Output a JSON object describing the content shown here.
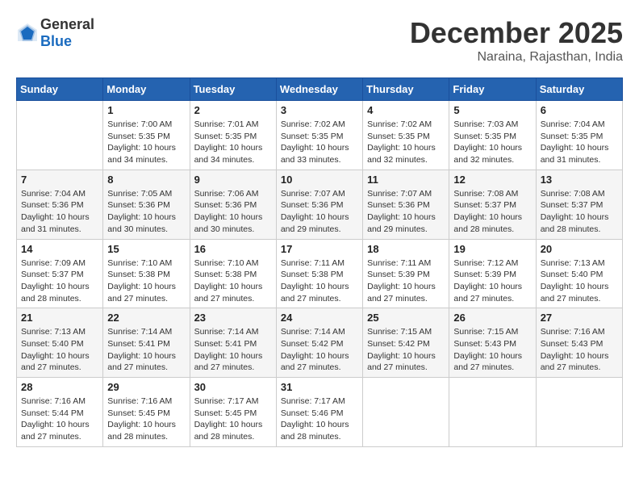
{
  "logo": {
    "general": "General",
    "blue": "Blue"
  },
  "title": {
    "month": "December 2025",
    "location": "Naraina, Rajasthan, India"
  },
  "headers": [
    "Sunday",
    "Monday",
    "Tuesday",
    "Wednesday",
    "Thursday",
    "Friday",
    "Saturday"
  ],
  "weeks": [
    [
      {
        "day": "",
        "info": ""
      },
      {
        "day": "1",
        "info": "Sunrise: 7:00 AM\nSunset: 5:35 PM\nDaylight: 10 hours\nand 34 minutes."
      },
      {
        "day": "2",
        "info": "Sunrise: 7:01 AM\nSunset: 5:35 PM\nDaylight: 10 hours\nand 34 minutes."
      },
      {
        "day": "3",
        "info": "Sunrise: 7:02 AM\nSunset: 5:35 PM\nDaylight: 10 hours\nand 33 minutes."
      },
      {
        "day": "4",
        "info": "Sunrise: 7:02 AM\nSunset: 5:35 PM\nDaylight: 10 hours\nand 32 minutes."
      },
      {
        "day": "5",
        "info": "Sunrise: 7:03 AM\nSunset: 5:35 PM\nDaylight: 10 hours\nand 32 minutes."
      },
      {
        "day": "6",
        "info": "Sunrise: 7:04 AM\nSunset: 5:35 PM\nDaylight: 10 hours\nand 31 minutes."
      }
    ],
    [
      {
        "day": "7",
        "info": "Sunrise: 7:04 AM\nSunset: 5:36 PM\nDaylight: 10 hours\nand 31 minutes."
      },
      {
        "day": "8",
        "info": "Sunrise: 7:05 AM\nSunset: 5:36 PM\nDaylight: 10 hours\nand 30 minutes."
      },
      {
        "day": "9",
        "info": "Sunrise: 7:06 AM\nSunset: 5:36 PM\nDaylight: 10 hours\nand 30 minutes."
      },
      {
        "day": "10",
        "info": "Sunrise: 7:07 AM\nSunset: 5:36 PM\nDaylight: 10 hours\nand 29 minutes."
      },
      {
        "day": "11",
        "info": "Sunrise: 7:07 AM\nSunset: 5:36 PM\nDaylight: 10 hours\nand 29 minutes."
      },
      {
        "day": "12",
        "info": "Sunrise: 7:08 AM\nSunset: 5:37 PM\nDaylight: 10 hours\nand 28 minutes."
      },
      {
        "day": "13",
        "info": "Sunrise: 7:08 AM\nSunset: 5:37 PM\nDaylight: 10 hours\nand 28 minutes."
      }
    ],
    [
      {
        "day": "14",
        "info": "Sunrise: 7:09 AM\nSunset: 5:37 PM\nDaylight: 10 hours\nand 28 minutes."
      },
      {
        "day": "15",
        "info": "Sunrise: 7:10 AM\nSunset: 5:38 PM\nDaylight: 10 hours\nand 27 minutes."
      },
      {
        "day": "16",
        "info": "Sunrise: 7:10 AM\nSunset: 5:38 PM\nDaylight: 10 hours\nand 27 minutes."
      },
      {
        "day": "17",
        "info": "Sunrise: 7:11 AM\nSunset: 5:38 PM\nDaylight: 10 hours\nand 27 minutes."
      },
      {
        "day": "18",
        "info": "Sunrise: 7:11 AM\nSunset: 5:39 PM\nDaylight: 10 hours\nand 27 minutes."
      },
      {
        "day": "19",
        "info": "Sunrise: 7:12 AM\nSunset: 5:39 PM\nDaylight: 10 hours\nand 27 minutes."
      },
      {
        "day": "20",
        "info": "Sunrise: 7:13 AM\nSunset: 5:40 PM\nDaylight: 10 hours\nand 27 minutes."
      }
    ],
    [
      {
        "day": "21",
        "info": "Sunrise: 7:13 AM\nSunset: 5:40 PM\nDaylight: 10 hours\nand 27 minutes."
      },
      {
        "day": "22",
        "info": "Sunrise: 7:14 AM\nSunset: 5:41 PM\nDaylight: 10 hours\nand 27 minutes."
      },
      {
        "day": "23",
        "info": "Sunrise: 7:14 AM\nSunset: 5:41 PM\nDaylight: 10 hours\nand 27 minutes."
      },
      {
        "day": "24",
        "info": "Sunrise: 7:14 AM\nSunset: 5:42 PM\nDaylight: 10 hours\nand 27 minutes."
      },
      {
        "day": "25",
        "info": "Sunrise: 7:15 AM\nSunset: 5:42 PM\nDaylight: 10 hours\nand 27 minutes."
      },
      {
        "day": "26",
        "info": "Sunrise: 7:15 AM\nSunset: 5:43 PM\nDaylight: 10 hours\nand 27 minutes."
      },
      {
        "day": "27",
        "info": "Sunrise: 7:16 AM\nSunset: 5:43 PM\nDaylight: 10 hours\nand 27 minutes."
      }
    ],
    [
      {
        "day": "28",
        "info": "Sunrise: 7:16 AM\nSunset: 5:44 PM\nDaylight: 10 hours\nand 27 minutes."
      },
      {
        "day": "29",
        "info": "Sunrise: 7:16 AM\nSunset: 5:45 PM\nDaylight: 10 hours\nand 28 minutes."
      },
      {
        "day": "30",
        "info": "Sunrise: 7:17 AM\nSunset: 5:45 PM\nDaylight: 10 hours\nand 28 minutes."
      },
      {
        "day": "31",
        "info": "Sunrise: 7:17 AM\nSunset: 5:46 PM\nDaylight: 10 hours\nand 28 minutes."
      },
      {
        "day": "",
        "info": ""
      },
      {
        "day": "",
        "info": ""
      },
      {
        "day": "",
        "info": ""
      }
    ]
  ]
}
